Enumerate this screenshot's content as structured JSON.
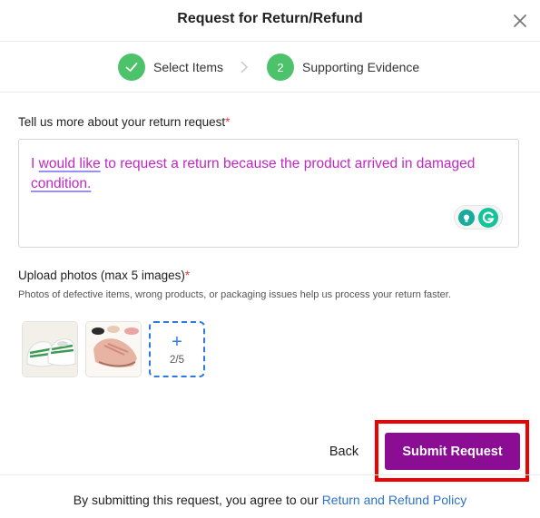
{
  "dialog": {
    "title": "Request for Return/Refund",
    "close_icon": "close-icon"
  },
  "steps": [
    {
      "label": "Select Items",
      "state": "completed",
      "icon": "check-icon"
    },
    {
      "label": "Supporting Evidence",
      "number": "2",
      "state": "active"
    }
  ],
  "colors": {
    "step_green": "#4cc36b",
    "submit": "#8a0d94",
    "link": "#2e73c8",
    "required": "#e5383b",
    "highlight": "#ec0000",
    "typed_text": "#c127c3"
  },
  "reason": {
    "label": "Tell us more about your return request",
    "required_mark": "*",
    "text_part1": "I ",
    "text_flagged": "would like",
    "text_part2": " to request a return because the product arrived in damaged ",
    "text_flagged2": "condition.",
    "assistant_icons": [
      "bulb-icon",
      "grammarly-icon"
    ]
  },
  "photos": {
    "label": "Upload photos (max 5 images)",
    "required_mark": "*",
    "hint": "Photos of defective items, wrong products, or packaging issues help us process your return faster.",
    "thumbnails": [
      "white-green-baby-shoes",
      "pink-baby-shoes"
    ],
    "add_plus": "+",
    "count": "2/5"
  },
  "actions": {
    "back": "Back",
    "submit": "Submit Request"
  },
  "footer": {
    "text": "By submitting this request, you agree to our ",
    "link": "Return and Refund Policy"
  }
}
